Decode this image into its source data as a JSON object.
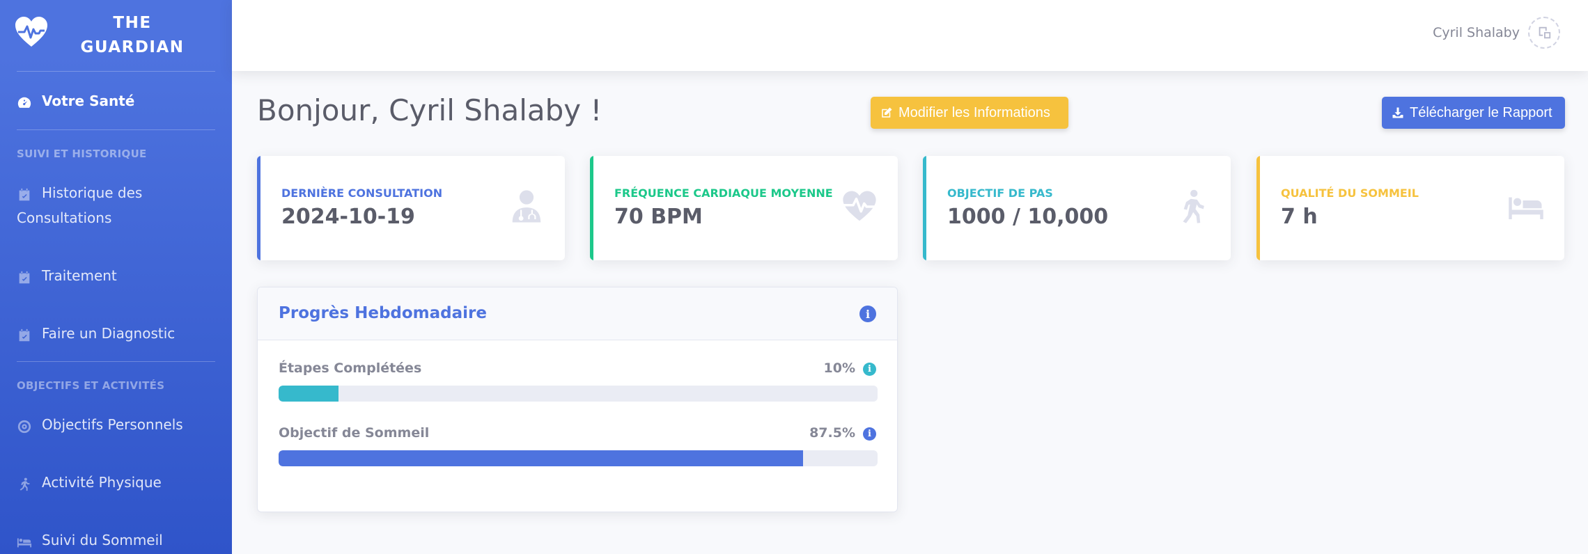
{
  "brand": {
    "line1": "THE",
    "line2": "GUARDIAN"
  },
  "sidebar": {
    "active_item": "Votre Santé",
    "section1_heading": "SUIVI ET HISTORIQUE",
    "items1": [
      "Historique des",
      "Consultations",
      "Traitement",
      "Faire un Diagnostic"
    ],
    "section2_heading": "OBJECTIFS ET ACTIVITÉS",
    "items2": [
      "Objectifs Personnels",
      "Activité Physique",
      "Suivi du Sommeil"
    ]
  },
  "topbar": {
    "user_name": "Cyril Shalaby",
    "avatar_icon": "user-image-icon"
  },
  "header": {
    "greeting": "Bonjour, Cyril Shalaby !",
    "edit_button": "Modifier les Informations",
    "download_button": "Télécharger le Rapport"
  },
  "cards": [
    {
      "label": "DERNIÈRE CONSULTATION",
      "value": "2024-10-19",
      "color": "#4e73df",
      "icon": "doctor-icon"
    },
    {
      "label": "FRÉQUENCE CARDIAQUE MOYENNE",
      "value": "70 BPM",
      "color": "#1cc88a",
      "icon": "heartbeat-icon"
    },
    {
      "label": "OBJECTIF DE PAS",
      "value": "1000 / 10,000",
      "color": "#36b9cc",
      "icon": "walking-icon"
    },
    {
      "label": "QUALITÉ DU SOMMEIL",
      "value": "7 h",
      "color": "#f6c23e",
      "icon": "bed-icon"
    }
  ],
  "progress": {
    "title": "Progrès Hebdomadaire",
    "rows": [
      {
        "label": "Étapes Complétées",
        "pct_text": "10%",
        "fraction": 0.1,
        "color": "#36b9cc"
      },
      {
        "label": "Objectif de Sommeil",
        "pct_text": "87.5%",
        "fraction": 0.875,
        "color": "#4e73df"
      }
    ]
  }
}
